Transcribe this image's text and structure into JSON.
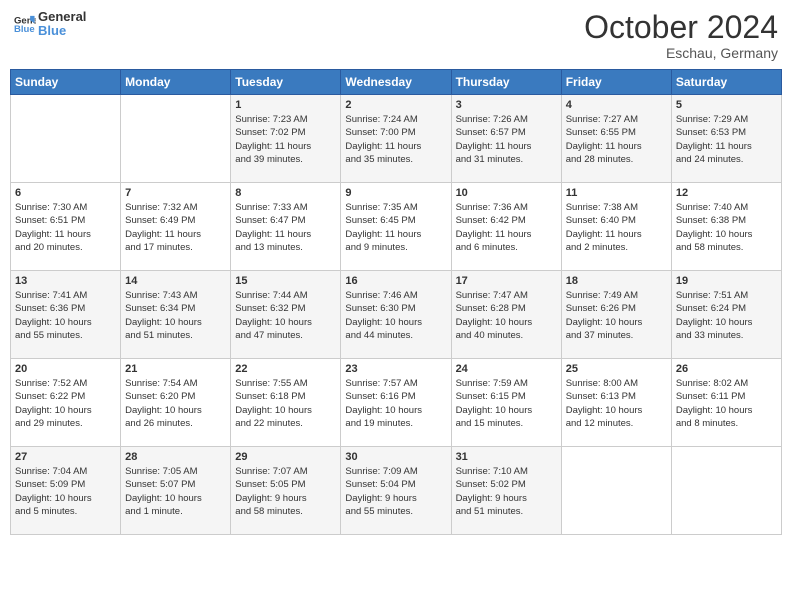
{
  "header": {
    "logo_general": "General",
    "logo_blue": "Blue",
    "month_title": "October 2024",
    "subtitle": "Eschau, Germany"
  },
  "days_of_week": [
    "Sunday",
    "Monday",
    "Tuesday",
    "Wednesday",
    "Thursday",
    "Friday",
    "Saturday"
  ],
  "weeks": [
    [
      {
        "day": "",
        "info": ""
      },
      {
        "day": "",
        "info": ""
      },
      {
        "day": "1",
        "info": "Sunrise: 7:23 AM\nSunset: 7:02 PM\nDaylight: 11 hours\nand 39 minutes."
      },
      {
        "day": "2",
        "info": "Sunrise: 7:24 AM\nSunset: 7:00 PM\nDaylight: 11 hours\nand 35 minutes."
      },
      {
        "day": "3",
        "info": "Sunrise: 7:26 AM\nSunset: 6:57 PM\nDaylight: 11 hours\nand 31 minutes."
      },
      {
        "day": "4",
        "info": "Sunrise: 7:27 AM\nSunset: 6:55 PM\nDaylight: 11 hours\nand 28 minutes."
      },
      {
        "day": "5",
        "info": "Sunrise: 7:29 AM\nSunset: 6:53 PM\nDaylight: 11 hours\nand 24 minutes."
      }
    ],
    [
      {
        "day": "6",
        "info": "Sunrise: 7:30 AM\nSunset: 6:51 PM\nDaylight: 11 hours\nand 20 minutes."
      },
      {
        "day": "7",
        "info": "Sunrise: 7:32 AM\nSunset: 6:49 PM\nDaylight: 11 hours\nand 17 minutes."
      },
      {
        "day": "8",
        "info": "Sunrise: 7:33 AM\nSunset: 6:47 PM\nDaylight: 11 hours\nand 13 minutes."
      },
      {
        "day": "9",
        "info": "Sunrise: 7:35 AM\nSunset: 6:45 PM\nDaylight: 11 hours\nand 9 minutes."
      },
      {
        "day": "10",
        "info": "Sunrise: 7:36 AM\nSunset: 6:42 PM\nDaylight: 11 hours\nand 6 minutes."
      },
      {
        "day": "11",
        "info": "Sunrise: 7:38 AM\nSunset: 6:40 PM\nDaylight: 11 hours\nand 2 minutes."
      },
      {
        "day": "12",
        "info": "Sunrise: 7:40 AM\nSunset: 6:38 PM\nDaylight: 10 hours\nand 58 minutes."
      }
    ],
    [
      {
        "day": "13",
        "info": "Sunrise: 7:41 AM\nSunset: 6:36 PM\nDaylight: 10 hours\nand 55 minutes."
      },
      {
        "day": "14",
        "info": "Sunrise: 7:43 AM\nSunset: 6:34 PM\nDaylight: 10 hours\nand 51 minutes."
      },
      {
        "day": "15",
        "info": "Sunrise: 7:44 AM\nSunset: 6:32 PM\nDaylight: 10 hours\nand 47 minutes."
      },
      {
        "day": "16",
        "info": "Sunrise: 7:46 AM\nSunset: 6:30 PM\nDaylight: 10 hours\nand 44 minutes."
      },
      {
        "day": "17",
        "info": "Sunrise: 7:47 AM\nSunset: 6:28 PM\nDaylight: 10 hours\nand 40 minutes."
      },
      {
        "day": "18",
        "info": "Sunrise: 7:49 AM\nSunset: 6:26 PM\nDaylight: 10 hours\nand 37 minutes."
      },
      {
        "day": "19",
        "info": "Sunrise: 7:51 AM\nSunset: 6:24 PM\nDaylight: 10 hours\nand 33 minutes."
      }
    ],
    [
      {
        "day": "20",
        "info": "Sunrise: 7:52 AM\nSunset: 6:22 PM\nDaylight: 10 hours\nand 29 minutes."
      },
      {
        "day": "21",
        "info": "Sunrise: 7:54 AM\nSunset: 6:20 PM\nDaylight: 10 hours\nand 26 minutes."
      },
      {
        "day": "22",
        "info": "Sunrise: 7:55 AM\nSunset: 6:18 PM\nDaylight: 10 hours\nand 22 minutes."
      },
      {
        "day": "23",
        "info": "Sunrise: 7:57 AM\nSunset: 6:16 PM\nDaylight: 10 hours\nand 19 minutes."
      },
      {
        "day": "24",
        "info": "Sunrise: 7:59 AM\nSunset: 6:15 PM\nDaylight: 10 hours\nand 15 minutes."
      },
      {
        "day": "25",
        "info": "Sunrise: 8:00 AM\nSunset: 6:13 PM\nDaylight: 10 hours\nand 12 minutes."
      },
      {
        "day": "26",
        "info": "Sunrise: 8:02 AM\nSunset: 6:11 PM\nDaylight: 10 hours\nand 8 minutes."
      }
    ],
    [
      {
        "day": "27",
        "info": "Sunrise: 7:04 AM\nSunset: 5:09 PM\nDaylight: 10 hours\nand 5 minutes."
      },
      {
        "day": "28",
        "info": "Sunrise: 7:05 AM\nSunset: 5:07 PM\nDaylight: 10 hours\nand 1 minute."
      },
      {
        "day": "29",
        "info": "Sunrise: 7:07 AM\nSunset: 5:05 PM\nDaylight: 9 hours\nand 58 minutes."
      },
      {
        "day": "30",
        "info": "Sunrise: 7:09 AM\nSunset: 5:04 PM\nDaylight: 9 hours\nand 55 minutes."
      },
      {
        "day": "31",
        "info": "Sunrise: 7:10 AM\nSunset: 5:02 PM\nDaylight: 9 hours\nand 51 minutes."
      },
      {
        "day": "",
        "info": ""
      },
      {
        "day": "",
        "info": ""
      }
    ]
  ]
}
